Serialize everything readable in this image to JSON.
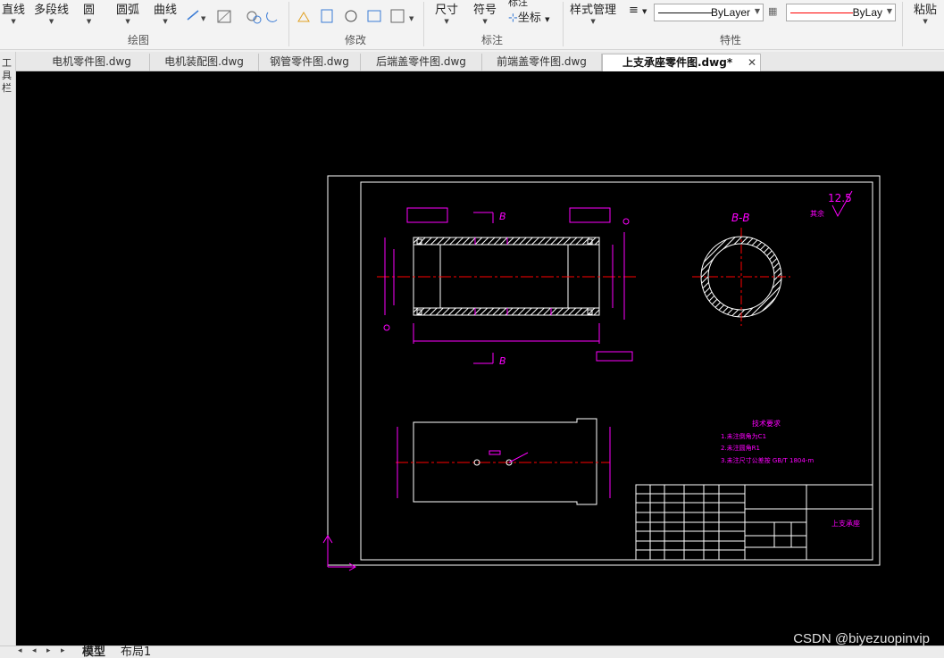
{
  "ribbon": {
    "draw": {
      "line": "直线",
      "polyline": "多段线",
      "circle": "圆",
      "arc": "圆弧",
      "curve": "曲线",
      "group_label": "绘图"
    },
    "modify": {
      "group_label": "修改"
    },
    "annotate": {
      "dimension": "尺寸",
      "symbol": "符号",
      "coordinate": "坐标",
      "partial_label": "标注",
      "group_label": "标注"
    },
    "properties": {
      "style_manager": "样式管理",
      "layer_line_1": "ByLayer",
      "layer_line_2": "ByLay",
      "group_label": "特性"
    },
    "clipboard": {
      "paste": "粘贴"
    }
  },
  "tabs": [
    {
      "label": "电机零件图.dwg"
    },
    {
      "label": "电机装配图.dwg"
    },
    {
      "label": "钢管零件图.dwg"
    },
    {
      "label": "后端盖零件图.dwg"
    },
    {
      "label": "前端盖零件图.dwg"
    },
    {
      "label": "上支承座零件图.dwg*",
      "active": true
    }
  ],
  "left_strip": [
    "工",
    "具",
    "栏"
  ],
  "drawing": {
    "section_label": "B-B",
    "section_mark": "B",
    "roughness": "12.5",
    "roughness_prefix": "其余",
    "notes_title": "技术要求",
    "notes": [
      "1.未注倒角为C1",
      "2.未注圆角R1",
      "3.未注尺寸公差按 GB/T 1804-m"
    ],
    "title_block_name": "上支承座"
  },
  "layout_tabs": [
    {
      "label": "模型",
      "active": true
    },
    {
      "label": "布局1"
    }
  ],
  "watermark": "CSDN @biyezuopinvip",
  "colors": {
    "canvas": "#000000",
    "magenta": "#ff00ff",
    "red": "#ff0000",
    "white": "#ffffff",
    "ribbon": "#f3f3f3"
  }
}
